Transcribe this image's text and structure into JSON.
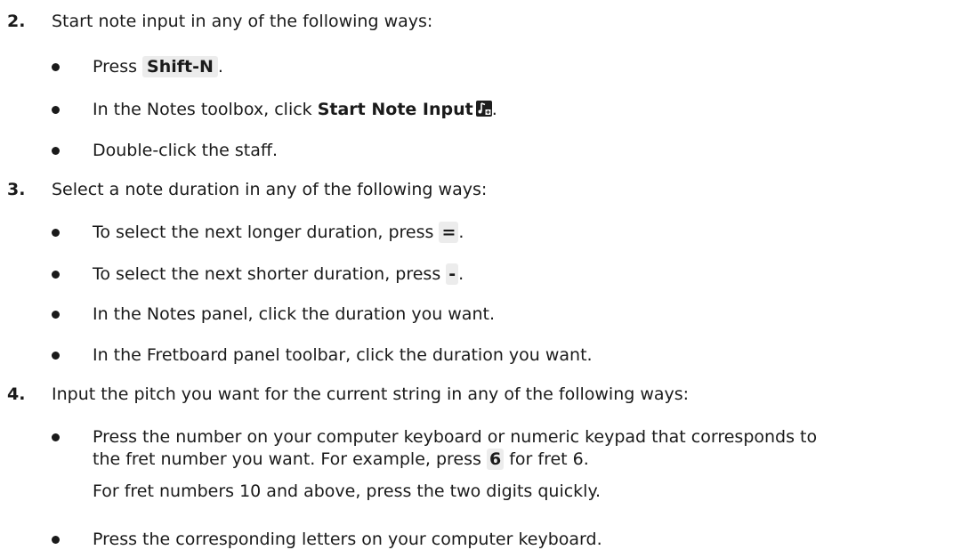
{
  "steps": [
    {
      "number": "2.",
      "text": "Start note input in any of the following ways:",
      "bullets": [
        {
          "pre": "Press ",
          "key": "Shift-N",
          "post": "."
        },
        {
          "pre": "In the Notes toolbox, click ",
          "bold": "Start Note Input",
          "icon": "start-note-input-icon",
          "post": "."
        },
        {
          "text": "Double-click the staff."
        }
      ]
    },
    {
      "number": "3.",
      "text": "Select a note duration in any of the following ways:",
      "bullets": [
        {
          "pre": "To select the next longer duration, press ",
          "key": "=",
          "post": "."
        },
        {
          "pre": "To select the next shorter duration, press ",
          "key": "-",
          "post": "."
        },
        {
          "text": "In the Notes panel, click the duration you want."
        },
        {
          "text": "In the Fretboard panel toolbar, click the duration you want."
        }
      ]
    },
    {
      "number": "4.",
      "text": "Input the pitch you want for the current string in any of the following ways:",
      "bullets": [
        {
          "line1": "Press the number on your computer keyboard or numeric keypad that corresponds to",
          "pre": "the fret number you want. For example, press ",
          "key": "6",
          "post": " for fret 6.",
          "continuation": "For fret numbers 10 and above, press the two digits quickly."
        },
        {
          "text": "Press the corresponding letters on your computer keyboard."
        }
      ]
    }
  ]
}
